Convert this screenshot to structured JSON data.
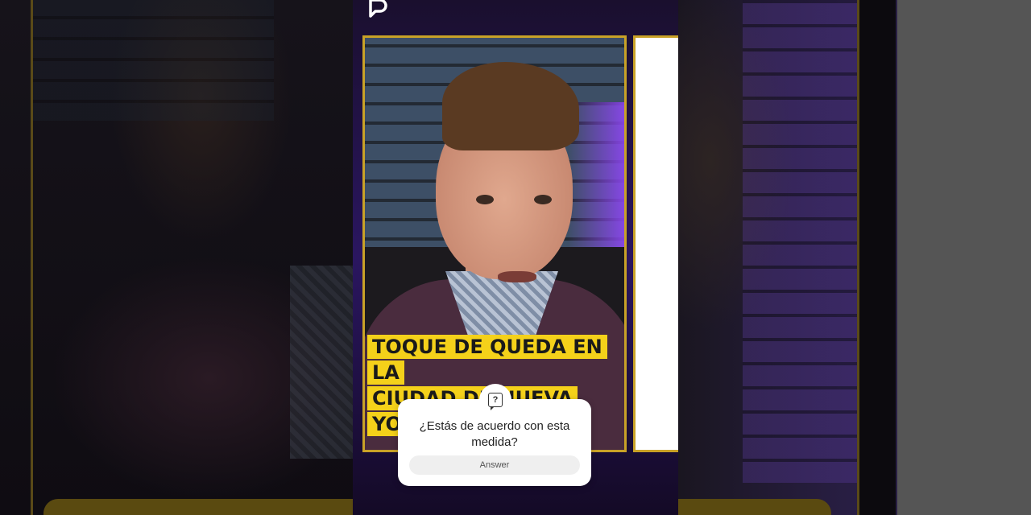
{
  "video": {
    "caption_line1": "TOQUE DE QUEDA EN LA",
    "caption_line2": "CIUDAD DE NUEVA YORK"
  },
  "question_sticker": {
    "icon": "question-bubble-icon",
    "question": "¿Estás de acuerdo con esta medida?",
    "answer_placeholder": "Answer"
  },
  "colors": {
    "frame_gold": "#c9a227",
    "caption_highlight": "#f4d11a"
  }
}
